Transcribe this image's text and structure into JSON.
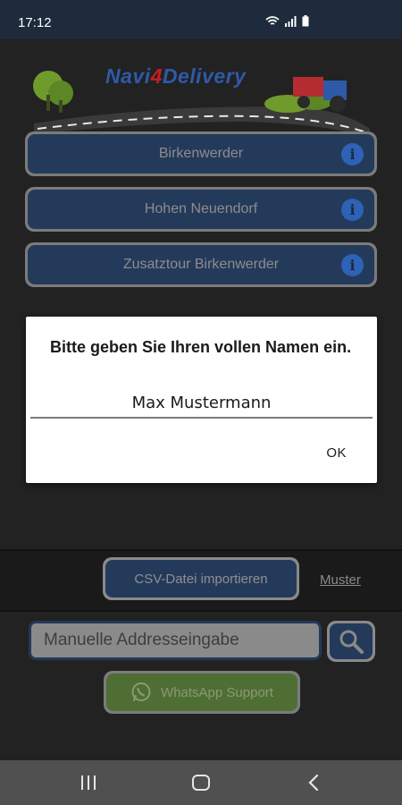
{
  "status_bar": {
    "time": "17:12",
    "icons": [
      "wifi-icon",
      "signal-icon",
      "battery-icon"
    ]
  },
  "app": {
    "logo_text_prefix": "Navi",
    "logo_text_four": "4",
    "logo_text_suffix": "Delivery",
    "tours": [
      {
        "label": "Birkenwerder",
        "info_icon": "info-icon"
      },
      {
        "label": "Hohen Neuendorf",
        "info_icon": "info-icon"
      },
      {
        "label": "Zusatztour Birkenwerder",
        "info_icon": "info-icon"
      }
    ],
    "info_glyph": "i"
  },
  "dialog": {
    "message": "Bitte geben Sie Ihren vollen Namen ein.",
    "input_value": "Max Mustermann",
    "ok_label": "OK"
  },
  "bottom": {
    "csv_label": "CSV-Datei importieren",
    "muster_label": "Muster",
    "address_placeholder": "Manuelle Addresseingabe",
    "whatsapp_label": "WhatsApp Support"
  },
  "colors": {
    "status_bar": "#1e2b3c",
    "app_background": "#222222",
    "button_fill": "#243a5b",
    "info_icon": "#2d62b6",
    "whatsapp_fill": "#4f6e34",
    "nav_bar": "#505050"
  }
}
